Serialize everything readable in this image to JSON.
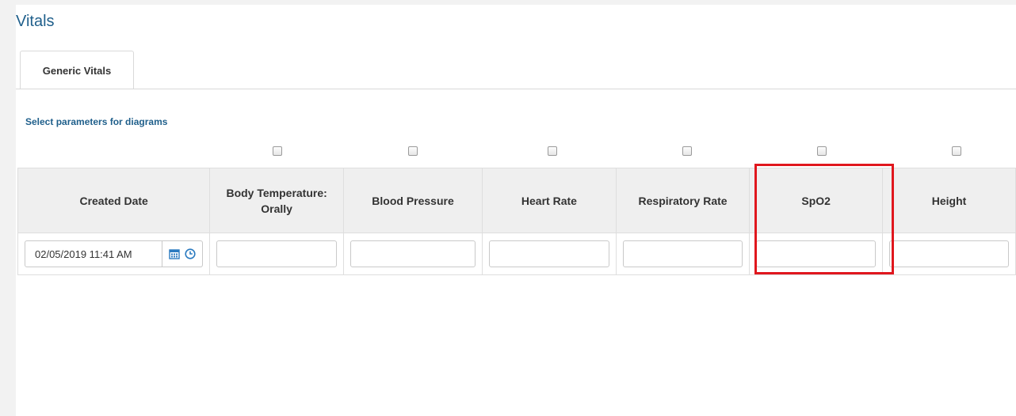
{
  "page": {
    "title": "Vitals"
  },
  "tabs": [
    {
      "label": "Generic Vitals",
      "active": true
    }
  ],
  "section": {
    "label": "Select parameters for diagrams"
  },
  "columns": [
    {
      "key": "created_date",
      "header": "Created Date",
      "checkbox": false
    },
    {
      "key": "body_temperature",
      "header": "Body Temperature: Orally",
      "checkbox": true,
      "checked": false
    },
    {
      "key": "blood_pressure",
      "header": "Blood Pressure",
      "checkbox": true,
      "checked": false
    },
    {
      "key": "heart_rate",
      "header": "Heart Rate",
      "checkbox": true,
      "checked": false
    },
    {
      "key": "respiratory_rate",
      "header": "Respiratory Rate",
      "checkbox": true,
      "checked": false
    },
    {
      "key": "spo2",
      "header": "SpO2",
      "checkbox": true,
      "checked": false
    },
    {
      "key": "height",
      "header": "Height",
      "checkbox": true,
      "checked": false
    }
  ],
  "row": {
    "created_date": "02/05/2019 11:41 AM",
    "body_temperature": "",
    "blood_pressure": "",
    "heart_rate": "",
    "respiratory_rate": "",
    "spo2": "",
    "height": ""
  },
  "icons": {
    "calendar": "calendar-icon",
    "clock": "clock-icon"
  },
  "colors": {
    "title": "#1f5f8b",
    "highlight": "#e0171e",
    "icon": "#2a7ac0"
  }
}
